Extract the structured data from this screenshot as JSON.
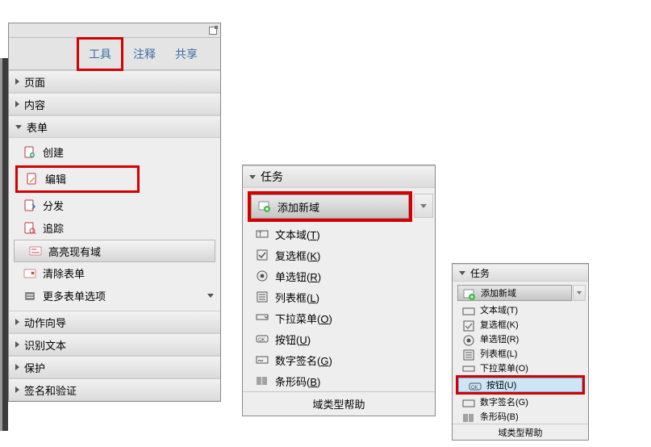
{
  "tabs": {
    "tools": "工具",
    "comment": "注释",
    "share": "共享"
  },
  "sections": {
    "pages": "页面",
    "content": "内容",
    "forms": "表单",
    "action": "动作向导",
    "ocr": "识别文本",
    "protect": "保护",
    "sign": "签名和验证"
  },
  "forms_items": {
    "create": "创建",
    "edit": "编辑",
    "distribute": "分发",
    "track": "追踪",
    "highlight": "高亮现有域",
    "clear": "清除表单",
    "more": "更多表单选项"
  },
  "tasks": {
    "header": "任务",
    "add": "添加新域",
    "textfield": "文本域",
    "textfield_k": "T",
    "checkbox": "复选框",
    "checkbox_k": "K",
    "radio": "单选钮",
    "radio_k": "R",
    "listbox": "列表框",
    "listbox_k": "L",
    "dropdown": "下拉菜单",
    "dropdown_k": "O",
    "button": "按钮",
    "button_k": "U",
    "signature": "数字签名",
    "signature_k": "G",
    "barcode": "条形码",
    "barcode_k": "B",
    "help": "域类型帮助"
  }
}
